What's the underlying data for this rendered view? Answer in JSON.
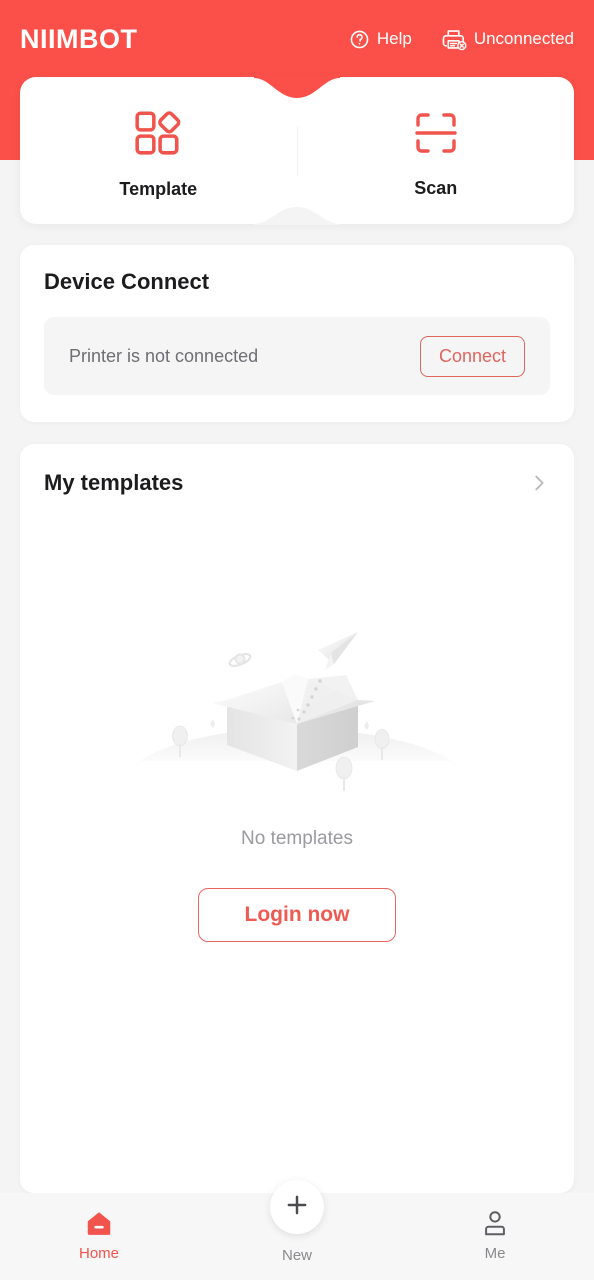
{
  "header": {
    "brand": "NIIMBOT",
    "help_label": "Help",
    "help_icon": "question-circle-icon",
    "connection_label": "Unconnected",
    "connection_icon": "printer-disconnected-icon",
    "background_color": "#fa5049"
  },
  "quick_actions": [
    {
      "label": "Template",
      "icon": "template-grid-icon"
    },
    {
      "label": "Scan",
      "icon": "scan-frame-icon"
    }
  ],
  "device_connect": {
    "title": "Device Connect",
    "status_text": "Printer is not connected",
    "connect_button": "Connect",
    "accent_color": "#e0655e"
  },
  "my_templates": {
    "title": "My templates",
    "chevron_icon": "chevron-right-icon",
    "empty_illustration": "open-box-paper-plane-illustration",
    "empty_text": "No templates",
    "login_button": "Login now",
    "login_color": "#ef5a52"
  },
  "bottom_nav": {
    "items": [
      {
        "label": "Home",
        "icon": "home-icon",
        "active": true
      },
      {
        "label": "New",
        "icon": "plus-icon",
        "active": false
      },
      {
        "label": "Me",
        "icon": "person-icon",
        "active": false
      }
    ],
    "active_color": "#f0544c",
    "inactive_color": "#8a8a8e"
  }
}
